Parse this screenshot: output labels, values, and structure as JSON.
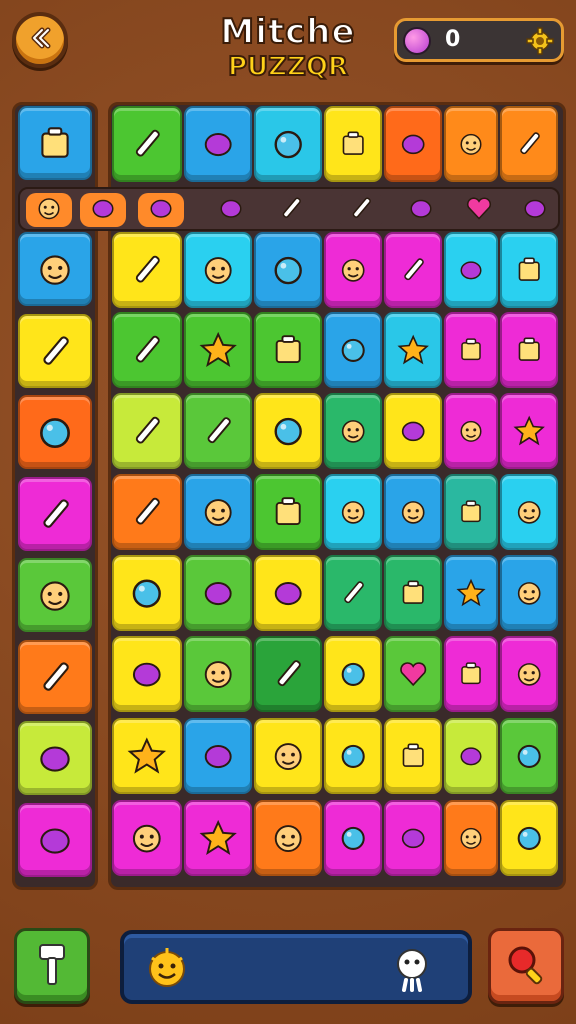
{
  "header": {
    "title_line1": "Mitche",
    "title_line2": "PUZZQR",
    "score": "0"
  },
  "colors": {
    "background": "#8a4a22",
    "panel": "#3a2a2a",
    "accent_orange": "#f0a12c",
    "footer_bar": "#1f4077"
  },
  "side_tiles": [
    {
      "color": "#2aa4e8",
      "icon": "lunchbox-icon"
    },
    {
      "color": "#2aa4e8",
      "icon": "girl-face-icon"
    },
    {
      "color": "#ffe51a",
      "icon": "brush-icon"
    },
    {
      "color": "#ff6a1a",
      "icon": "plum-icon"
    },
    {
      "color": "#ee2bd6",
      "icon": "pickle-icon"
    },
    {
      "color": "#5ac83a",
      "icon": "smiley-blob-icon"
    },
    {
      "color": "#ff7a1a",
      "icon": "wand-icon"
    },
    {
      "color": "#c7ea3a",
      "icon": "microphone-icon"
    },
    {
      "color": "#ee2bd6",
      "icon": "bracelet-icon"
    }
  ],
  "strip_items": [
    {
      "color": "#ff8a2a",
      "icon": "face-icon"
    },
    {
      "color": "#ff8a2a",
      "icon": "blue-blob-icon"
    },
    {
      "color": "#ff8a2a",
      "icon": "pink-blob-icon"
    },
    {
      "color": "#4a3434",
      "icon": "snail-icon"
    },
    {
      "color": "#4a3434",
      "icon": "leaf-icon"
    },
    {
      "color": "#4a3434",
      "icon": "green-leaf-icon"
    },
    {
      "color": "#4a3434",
      "icon": "sprout-icon"
    },
    {
      "color": "#4a3434",
      "icon": "heart-icon"
    },
    {
      "color": "#4a3434",
      "icon": "blue-flower-icon"
    }
  ],
  "board_rows": [
    [
      {
        "color": "#4cc631",
        "icon": "pencil-icon"
      },
      {
        "color": "#2aa4e8",
        "icon": "pink-blob-icon"
      },
      {
        "color": "#2ac7e8",
        "icon": "mirror-icon"
      },
      {
        "color": "#ffe51a",
        "icon": "box-icon"
      },
      {
        "color": "#ff6a1a",
        "icon": "lollipop-icon"
      },
      {
        "color": "#ff8a1a",
        "icon": "cactus-face-icon"
      },
      {
        "color": "#ff8a1a",
        "icon": "feather-icon"
      }
    ],
    [
      {
        "color": "#ffe51a",
        "icon": "pencil-icon"
      },
      {
        "color": "#2ad0f0",
        "icon": "fruit-face-icon"
      },
      {
        "color": "#2aa4e8",
        "icon": "mirror-icon"
      },
      {
        "color": "#ee2bd6",
        "icon": "pharaoh-face-icon"
      },
      {
        "color": "#ee2bd6",
        "icon": "crayon-icon"
      },
      {
        "color": "#2ad0f0",
        "icon": "bird-icon"
      },
      {
        "color": "#2ad0f0",
        "icon": "book-icon"
      }
    ],
    [
      {
        "color": "#4cc631",
        "icon": "crayon-icon"
      },
      {
        "color": "#4cc631",
        "icon": "star-icon"
      },
      {
        "color": "#4cc631",
        "icon": "basket-icon"
      },
      {
        "color": "#2aa4e8",
        "icon": "ring-icon"
      },
      {
        "color": "#2ac7e8",
        "icon": "sun-red-icon"
      },
      {
        "color": "#ee2bd6",
        "icon": "jar-icon"
      },
      {
        "color": "#ee2bd6",
        "icon": "pot-icon"
      }
    ],
    [
      {
        "color": "#c7ea3a",
        "icon": "pickle-icon"
      },
      {
        "color": "#5ac83a",
        "icon": "carrot-icon"
      },
      {
        "color": "#ffe51a",
        "icon": "plum-icon"
      },
      {
        "color": "#2ab86a",
        "icon": "mask-icon"
      },
      {
        "color": "#ffe51a",
        "icon": "diamond-icon"
      },
      {
        "color": "#ee2bd6",
        "icon": "robot-icon"
      },
      {
        "color": "#ee2bd6",
        "icon": "sunflower-icon"
      }
    ],
    [
      {
        "color": "#ff7a1a",
        "icon": "leaf-icon"
      },
      {
        "color": "#2aa4e8",
        "icon": "boy-face-icon"
      },
      {
        "color": "#4cc631",
        "icon": "temple-icon"
      },
      {
        "color": "#2ad0f0",
        "icon": "smiley-icon"
      },
      {
        "color": "#2aa4e8",
        "icon": "chat-smiley-icon"
      },
      {
        "color": "#2ab8a0",
        "icon": "battery-icon"
      },
      {
        "color": "#2ad0f0",
        "icon": "sun-face-icon"
      }
    ],
    [
      {
        "color": "#ffe51a",
        "icon": "ball-icon"
      },
      {
        "color": "#5ac83a",
        "icon": "ice-cream-icon"
      },
      {
        "color": "#ffe51a",
        "icon": "eggplant-icon"
      },
      {
        "color": "#2ab86a",
        "icon": "pencil-icon"
      },
      {
        "color": "#2ab86a",
        "icon": "lamp-icon"
      },
      {
        "color": "#2aa4e8",
        "icon": "sun-red-icon"
      },
      {
        "color": "#2aa4e8",
        "icon": "sun-face-icon"
      }
    ],
    [
      {
        "color": "#ffe51a",
        "icon": "bow-icon"
      },
      {
        "color": "#5ac83a",
        "icon": "cat-face-icon"
      },
      {
        "color": "#2aa43a",
        "icon": "feather-icon"
      },
      {
        "color": "#ffe51a",
        "icon": "blue-ball-icon"
      },
      {
        "color": "#5ac83a",
        "icon": "heart-icon"
      },
      {
        "color": "#ee2bd6",
        "icon": "jar-icon"
      },
      {
        "color": "#ee2bd6",
        "icon": "robot-icon"
      }
    ],
    [
      {
        "color": "#ffe51a",
        "icon": "star-icon"
      },
      {
        "color": "#2aa4e8",
        "icon": "house-icon"
      },
      {
        "color": "#ffe51a",
        "icon": "boy-face-icon"
      },
      {
        "color": "#ffe51a",
        "icon": "bomb-icon"
      },
      {
        "color": "#ffe51a",
        "icon": "lantern-icon"
      },
      {
        "color": "#c7ea3a",
        "icon": "fish-icon"
      },
      {
        "color": "#5ac83a",
        "icon": "orange-icon"
      }
    ],
    [
      {
        "color": "#ee2bd6",
        "icon": "girl-face-icon"
      },
      {
        "color": "#ee2bd6",
        "icon": "sun-icon"
      },
      {
        "color": "#ff7a1a",
        "icon": "smiley-blob-icon"
      },
      {
        "color": "#ee2bd6",
        "icon": "blue-ball-icon"
      },
      {
        "color": "#ee2bd6",
        "icon": "strawberry-icon"
      },
      {
        "color": "#ff7a1a",
        "icon": "cactus-face-icon"
      },
      {
        "color": "#ffe51a",
        "icon": "apple-icon"
      }
    ]
  ],
  "footer": {
    "left_button_icon": "hammer-icon",
    "bar_left_icon": "sun-face-icon",
    "bar_right_icon": "ghost-icon",
    "right_button_icon": "magnifier-icon"
  }
}
